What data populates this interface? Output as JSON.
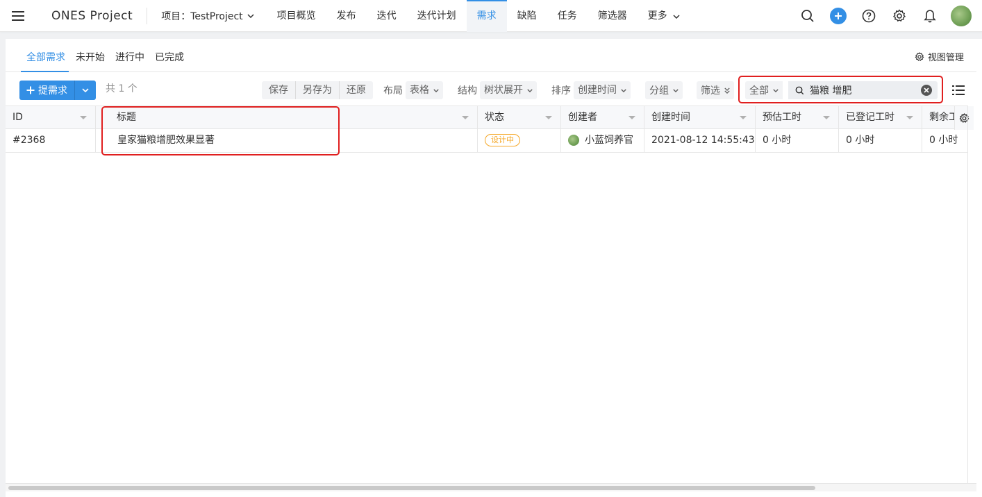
{
  "topnav": {
    "brand": "ONES Project",
    "project": "项目：TestProject",
    "tabs": [
      {
        "label": "项目概览"
      },
      {
        "label": "发布"
      },
      {
        "label": "迭代"
      },
      {
        "label": "迭代计划"
      },
      {
        "label": "需求"
      },
      {
        "label": "缺陷"
      },
      {
        "label": "任务"
      },
      {
        "label": "筛选器"
      },
      {
        "label": "更多"
      }
    ],
    "active_tab": "需求",
    "accent": "#338fe5"
  },
  "subtabs": {
    "items": [
      "全部需求",
      "未开始",
      "进行中",
      "已完成"
    ],
    "active": "全部需求",
    "view_manage": "视图管理"
  },
  "toolbar": {
    "add_label": "提需求",
    "total": "共 1 个",
    "save": "保存",
    "save_as": "另存为",
    "restore": "还原",
    "layout_label": "布局",
    "layout_value": "表格",
    "structure_label": "结构",
    "structure_value": "树状展开",
    "sort_label": "排序",
    "sort_value": "创建时间",
    "group_label": "分组",
    "filter_label": "筛选",
    "search_scope": "全部",
    "search_value": "猫粮 增肥"
  },
  "table": {
    "headers": [
      "ID",
      "标题",
      "状态",
      "创建者",
      "创建时间",
      "预估工时",
      "已登记工时",
      "剩余工"
    ],
    "rows": [
      {
        "id": "#2368",
        "title": "皇家猫粮增肥效果显著",
        "status": "设计中",
        "creator": "小蓝饲养官",
        "created": "2021-08-12 14:55:43",
        "estimate": "0 小时",
        "logged": "0 小时",
        "remaining": "0 小时"
      }
    ]
  },
  "colors": {
    "status_design": "#f5a623",
    "highlight": "#e01f1f"
  }
}
